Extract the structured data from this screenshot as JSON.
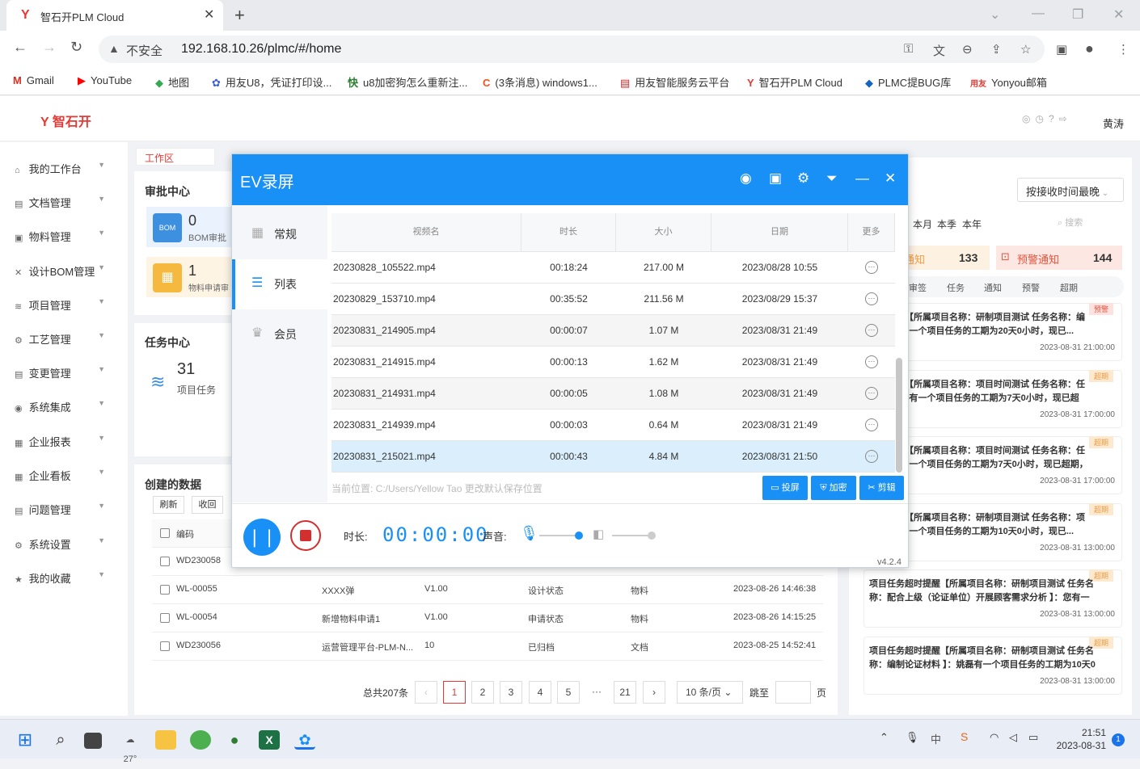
{
  "browser": {
    "tab_title": "智石开PLM Cloud",
    "insecure": "不安全",
    "url": "192.168.10.26/plmc/#/home",
    "bookmarks": [
      "Gmail",
      "YouTube",
      "地图",
      "用友U8，凭证打印设...",
      "u8加密狗怎么重新注...",
      "(3条消息) windows1...",
      "用友智能服务云平台",
      "智石开PLM Cloud",
      "PLMC提BUG库",
      "Yonyou邮箱"
    ]
  },
  "app": {
    "logo": "智石开",
    "user": "黄涛"
  },
  "sidebar": [
    "我的工作台",
    "文档管理",
    "物料管理",
    "设计BOM管理",
    "项目管理",
    "工艺管理",
    "变更管理",
    "系统集成",
    "企业报表",
    "企业看板",
    "问题管理",
    "系统设置",
    "我的收藏"
  ],
  "main": {
    "tab": "工作区",
    "approval_title": "审批中心",
    "bom_count": "0",
    "bom_label": "BOM审批",
    "mat_count": "1",
    "mat_label": "物料申请审",
    "task_title": "任务中心",
    "task_count": "31",
    "task_label": "项目任务",
    "created_title": "创建的数据",
    "refresh": "刷新",
    "recall": "收回",
    "col_code": "编码",
    "rows": [
      {
        "code": "WD230058",
        "name": "",
        "ver": "",
        "state": "",
        "type": "",
        "date": ""
      },
      {
        "code": "WL-00055",
        "name": "XXXX弹",
        "ver": "V1.00",
        "state": "设计状态",
        "type": "物料",
        "date": "2023-08-26 14:46:38"
      },
      {
        "code": "WL-00054",
        "name": "新增物料申请1",
        "ver": "V1.00",
        "state": "申请状态",
        "type": "物料",
        "date": "2023-08-26 14:15:25"
      },
      {
        "code": "WD230056",
        "name": "运营管理平台-PLM-N...",
        "ver": "10",
        "state": "已归档",
        "type": "文档",
        "date": "2023-08-25 14:52:41"
      }
    ],
    "total": "总共207条",
    "pages": [
      "1",
      "2",
      "3",
      "4",
      "5",
      "···",
      "21"
    ],
    "per_page": "10 条/页",
    "jump": "跳至",
    "page_unit": "页"
  },
  "right": {
    "sort": "按接收时间最晚",
    "periods": [
      "本月",
      "本季",
      "本年"
    ],
    "search_ph": "搜索",
    "notice_label": "通知",
    "notice_count": "133",
    "warn_label": "预警通知",
    "warn_count": "144",
    "tabs": [
      "审签",
      "任务",
      "通知",
      "预警",
      "超期"
    ],
    "notes": [
      {
        "text": "工期预警【所属项目名称：研制项目测试 任务名称：编写】：您有一个项目任务的工期为20天0小时，现已...",
        "date": "2023-08-31 21:00:00",
        "tag": "预警"
      },
      {
        "text": "超时提醒【所属项目名称：项目时间测试 任务名称：任务】：黄涛有一个项目任务的工期为7天0小时，现已超期，...",
        "date": "2023-08-31 17:00:00",
        "tag": "超期"
      },
      {
        "text": "超时提醒【所属项目名称：项目时间测试 任务名称：任务】：您有一个项目任务的工期为7天0小时，现已超期，请...",
        "date": "2023-08-31 17:00:00",
        "tag": "超期"
      },
      {
        "text": "超时提醒【所属项目名称：研制项目测试 任务名称：项目】：您有一个项目任务的工期为10天0小时，现已...",
        "date": "2023-08-31 13:00:00",
        "tag": "超期"
      },
      {
        "text": "项目任务超时提醒【所属项目名称：研制项目测试 任务名称：配合上级（论证单位）开展顾客需求分析 】：您有一个项目任务...",
        "date": "2023-08-31 13:00:00",
        "tag": "超期"
      },
      {
        "text": "项目任务超时提醒【所属项目名称：研制项目测试 任务名称：编制论证材料 】：姚磊有一个项目任务的工期为10天0小时，现...",
        "date": "2023-08-31 13:00:00",
        "tag": "超期"
      }
    ]
  },
  "ev": {
    "title": "EV录屏",
    "nav": [
      "常规",
      "列表",
      "会员"
    ],
    "headers": [
      "视频名",
      "时长",
      "大小",
      "日期",
      "更多"
    ],
    "files": [
      {
        "name": "20230828_105522.mp4",
        "dur": "00:18:24",
        "size": "217.00 M",
        "date": "2023/08/28 10:55"
      },
      {
        "name": "20230829_153710.mp4",
        "dur": "00:35:52",
        "size": "211.56 M",
        "date": "2023/08/29 15:37"
      },
      {
        "name": "20230831_214905.mp4",
        "dur": "00:00:07",
        "size": "1.07 M",
        "date": "2023/08/31 21:49"
      },
      {
        "name": "20230831_214915.mp4",
        "dur": "00:00:13",
        "size": "1.62 M",
        "date": "2023/08/31 21:49"
      },
      {
        "name": "20230831_214931.mp4",
        "dur": "00:00:05",
        "size": "1.08 M",
        "date": "2023/08/31 21:49"
      },
      {
        "name": "20230831_214939.mp4",
        "dur": "00:00:03",
        "size": "0.64 M",
        "date": "2023/08/31 21:49"
      },
      {
        "name": "20230831_215021.mp4",
        "dur": "00:00:43",
        "size": "4.84 M",
        "date": "2023/08/31 21:50"
      }
    ],
    "path": "当前位置: C:/Users/Yellow Tao 更改默认保存位置",
    "btn_cast": "投屏",
    "btn_encrypt": "加密",
    "btn_cut": "剪辑",
    "dur_label": "时长:",
    "dur": "00:00:00",
    "sound_label": "声音:",
    "version": "v4.2.4"
  },
  "taskbar": {
    "temp": "27°",
    "time": "21:51",
    "date": "2023-08-31",
    "badge": "1"
  }
}
